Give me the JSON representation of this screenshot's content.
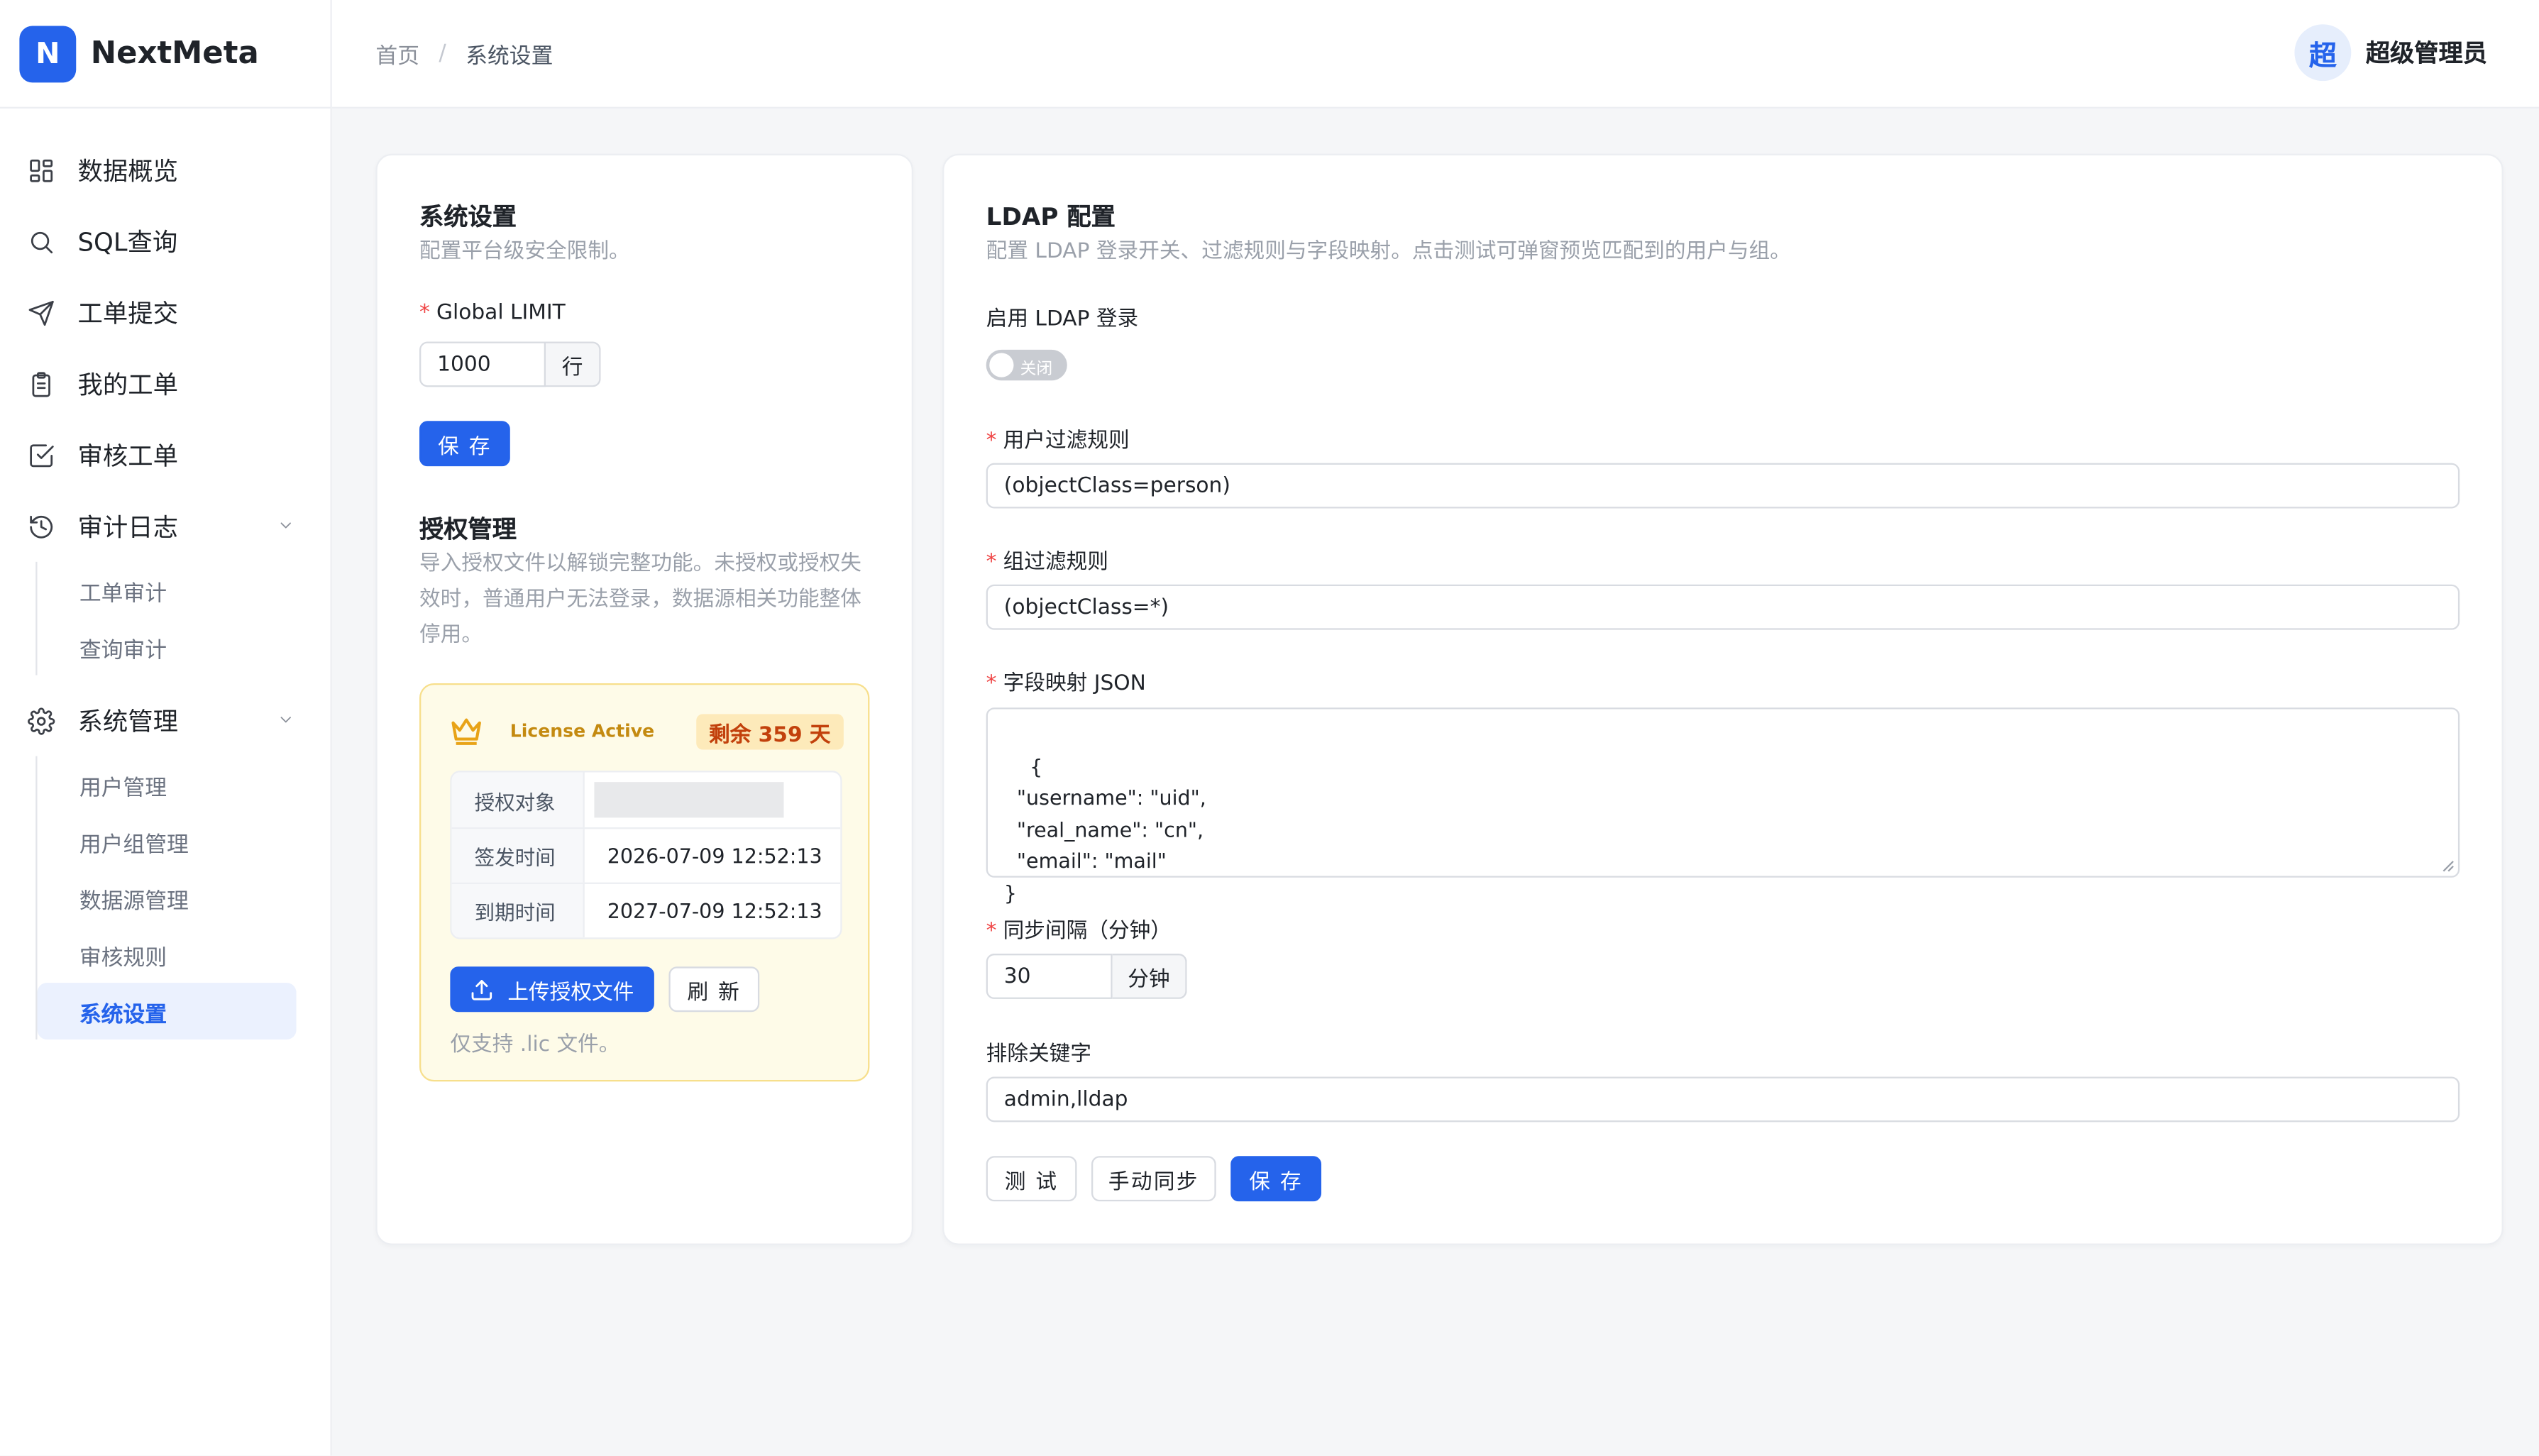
{
  "brand": {
    "logo_letter": "N",
    "name": "NextMeta",
    "accent": "#2563eb"
  },
  "nav": {
    "items": [
      {
        "label": "数据概览",
        "icon": "dashboard-grid-icon"
      },
      {
        "label": "SQL查询",
        "icon": "search-icon"
      },
      {
        "label": "工单提交",
        "icon": "send-icon"
      },
      {
        "label": "我的工单",
        "icon": "clipboard-icon"
      },
      {
        "label": "审核工单",
        "icon": "checkbox-icon"
      },
      {
        "label": "审计日志",
        "icon": "history-icon"
      },
      {
        "label": "系统管理",
        "icon": "gear-icon"
      }
    ],
    "audit_sub": [
      "工单审计",
      "查询审计"
    ],
    "system_sub": [
      "用户管理",
      "用户组管理",
      "数据源管理",
      "审核规则",
      "系统设置"
    ],
    "active": "系统设置"
  },
  "header": {
    "breadcrumb": [
      "首页",
      "系统设置"
    ],
    "separator": "/",
    "user": {
      "avatar": "超",
      "name": "超级管理员"
    }
  },
  "system": {
    "title": "系统设置",
    "desc": "配置平台级安全限制。",
    "limit_label": "Global LIMIT",
    "limit_value": "1000",
    "limit_unit": "行",
    "save_label": "保 存"
  },
  "license": {
    "title": "授权管理",
    "desc": "导入授权文件以解锁完整功能。未授权或授权失效时，普通用户无法登录，数据源相关功能整体停用。",
    "status": "License Active",
    "days_left": "剩余 359 天",
    "rows": [
      {
        "key": "授权对象",
        "value": ""
      },
      {
        "key": "签发时间",
        "value": "2026-07-09 12:52:13"
      },
      {
        "key": "到期时间",
        "value": "2027-07-09 12:52:13"
      }
    ],
    "upload_label": "上传授权文件",
    "refresh_label": "刷 新",
    "note": "仅支持 .lic 文件。"
  },
  "ldap": {
    "title": "LDAP 配置",
    "desc": "配置 LDAP 登录开关、过滤规则与字段映射。点击测试可弹窗预览匹配到的用户与组。",
    "enable_label": "启用 LDAP 登录",
    "enable_state": "关闭",
    "user_filter_label": "用户过滤规则",
    "user_filter": "(objectClass=person)",
    "group_filter_label": "组过滤规则",
    "group_filter": "(objectClass=*)",
    "mapping_label": "字段映射 JSON",
    "mapping": "{\n  \"username\": \"uid\",\n  \"real_name\": \"cn\",\n  \"email\": \"mail\"\n}",
    "interval_label": "同步间隔（分钟）",
    "interval": "30",
    "interval_unit": "分钟",
    "exclude_label": "排除关键字",
    "exclude": "admin,lldap",
    "test_label": "测 试",
    "sync_label": "手动同步",
    "save_label": "保 存"
  }
}
